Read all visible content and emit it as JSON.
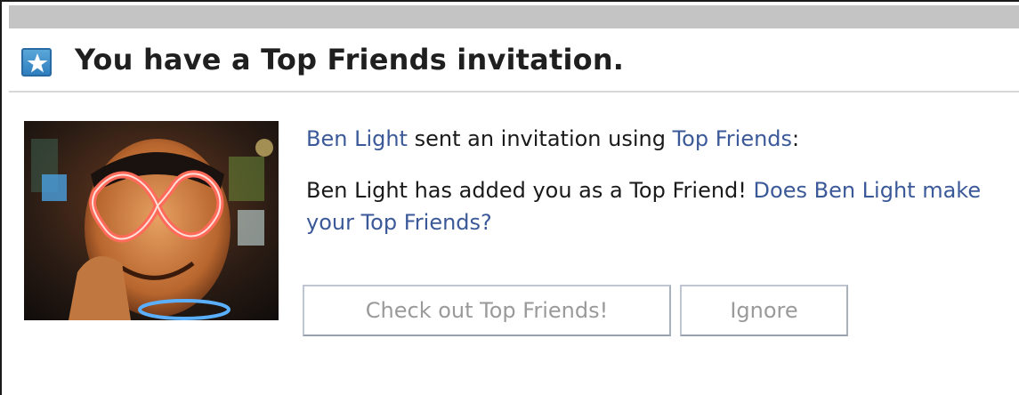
{
  "header": {
    "title": "You have a Top Friends invitation.",
    "icon": "star-icon"
  },
  "invitation": {
    "sender": "Ben Light",
    "sent_text": " sent an invitation using ",
    "app_name": "Top Friends",
    "colon": ":",
    "message": "Ben Light has added you as a Top Friend! ",
    "question_link": "Does Ben Light make your Top Friends?"
  },
  "buttons": {
    "accept_label": "Check out Top Friends!",
    "ignore_label": "Ignore"
  },
  "colors": {
    "link": "#3b5998",
    "icon_blue": "#3f8fcb",
    "top_bar": "#c4c4c4",
    "button_text": "#9a9a9a"
  }
}
